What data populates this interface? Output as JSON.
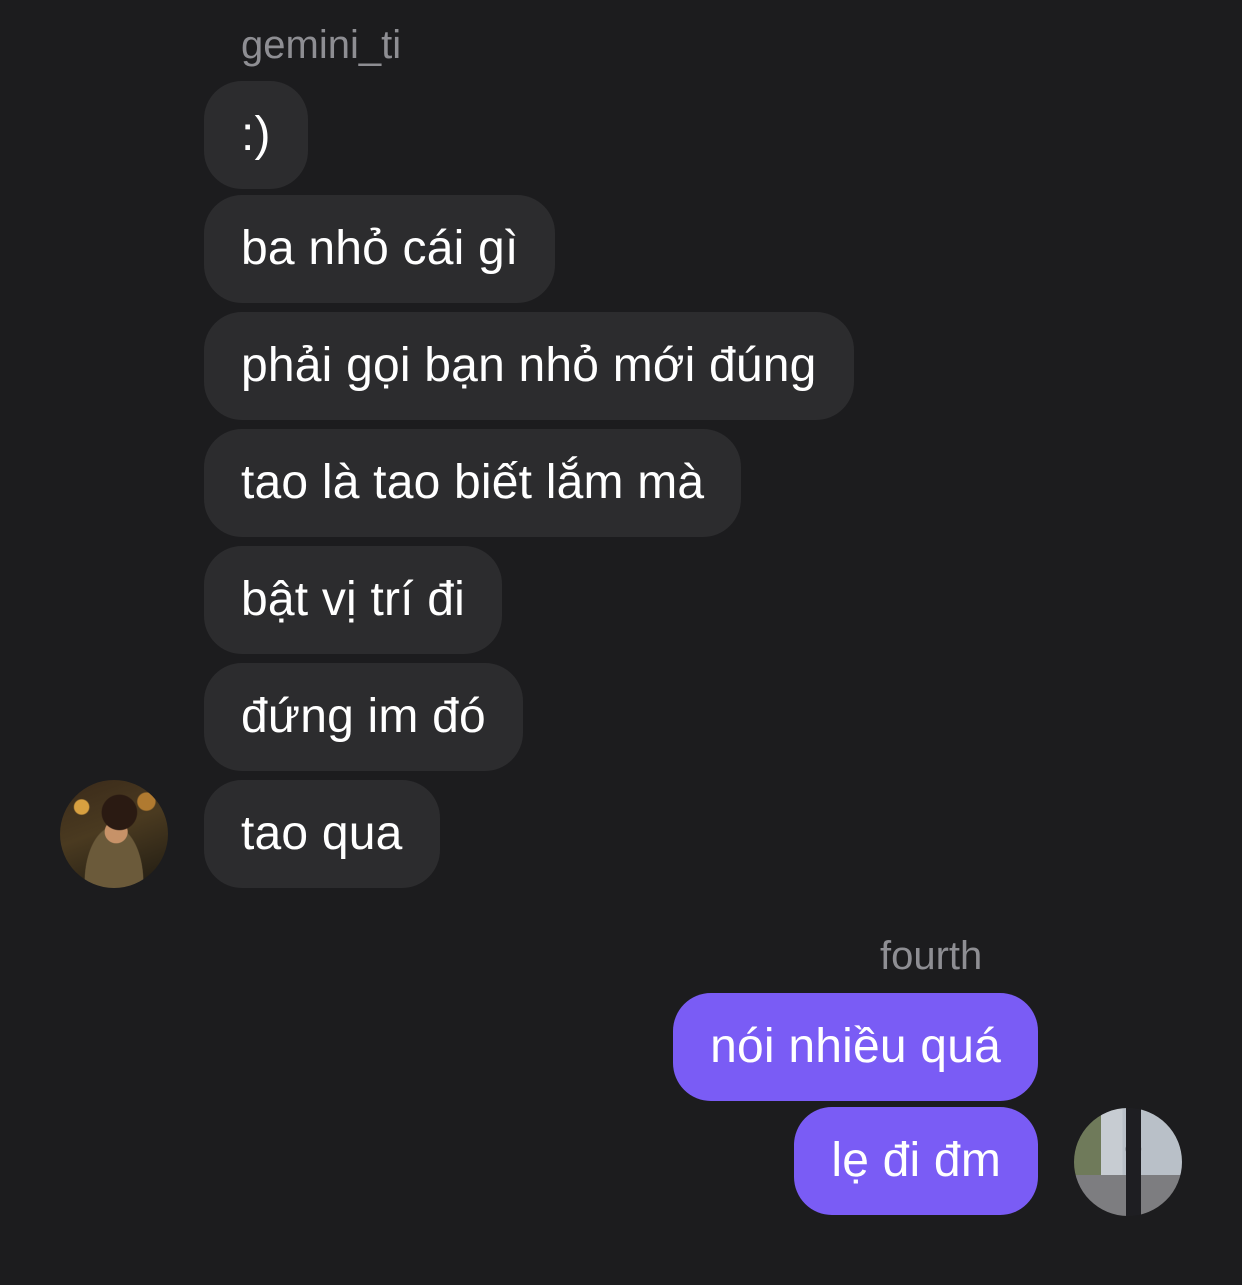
{
  "conversation": {
    "incoming": {
      "sender_name": "gemini_ti",
      "avatar_icon": "profile-photo-gemini",
      "messages": [
        ":)",
        "ba nhỏ cái gì",
        "phải gọi bạn nhỏ mới đúng",
        "tao là tao biết lắm mà",
        "bật vị trí đi",
        "đứng im đó",
        "tao qua"
      ]
    },
    "outgoing": {
      "sender_name": "fourth",
      "avatar_icon": "profile-photo-fourth",
      "messages": [
        "nói nhiều quá",
        "lẹ đi đm"
      ]
    }
  },
  "colors": {
    "background": "#1c1c1e",
    "incoming_bubble": "#2c2c2e",
    "outgoing_bubble": "#7a5cf5",
    "sender_name": "#8e8e93",
    "text": "#ffffff"
  }
}
